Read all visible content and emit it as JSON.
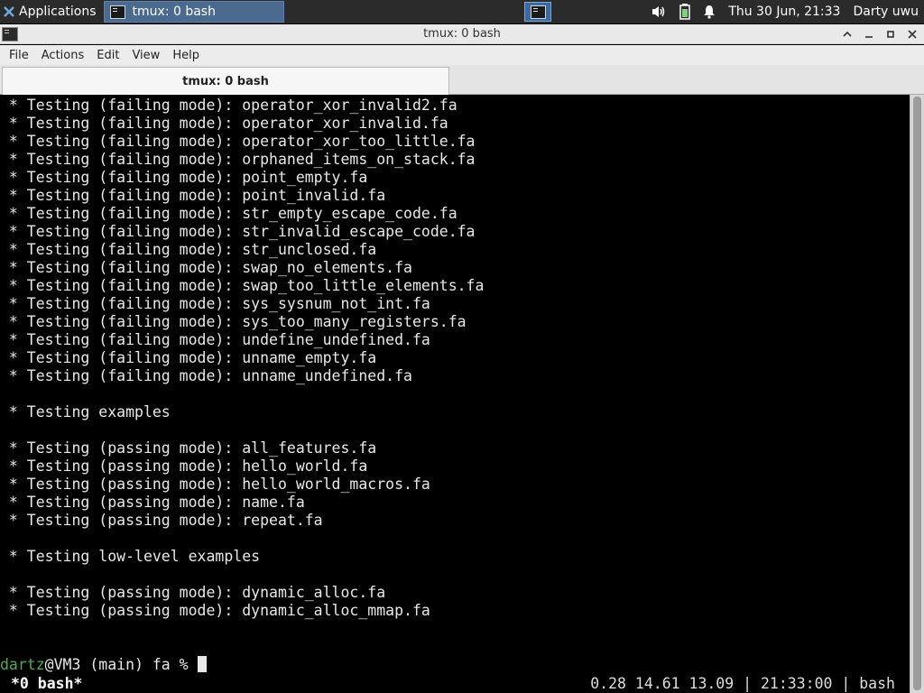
{
  "panel": {
    "applications_label": "Applications",
    "task_label": "tmux: 0 bash",
    "clock": "Thu 30 Jun, 21:33",
    "user": "Darty uwu",
    "icons": [
      "volume-icon",
      "battery-icon",
      "notification-bell-icon"
    ]
  },
  "window": {
    "title": "tmux: 0 bash",
    "menu": [
      "File",
      "Actions",
      "Edit",
      "View",
      "Help"
    ],
    "tab_label": "tmux: 0 bash"
  },
  "terminal": {
    "lines": [
      " * Testing (failing mode): operator_xor_invalid2.fa",
      " * Testing (failing mode): operator_xor_invalid.fa",
      " * Testing (failing mode): operator_xor_too_little.fa",
      " * Testing (failing mode): orphaned_items_on_stack.fa",
      " * Testing (failing mode): point_empty.fa",
      " * Testing (failing mode): point_invalid.fa",
      " * Testing (failing mode): str_empty_escape_code.fa",
      " * Testing (failing mode): str_invalid_escape_code.fa",
      " * Testing (failing mode): str_unclosed.fa",
      " * Testing (failing mode): swap_no_elements.fa",
      " * Testing (failing mode): swap_too_little_elements.fa",
      " * Testing (failing mode): sys_sysnum_not_int.fa",
      " * Testing (failing mode): sys_too_many_registers.fa",
      " * Testing (failing mode): undefine_undefined.fa",
      " * Testing (failing mode): unname_empty.fa",
      " * Testing (failing mode): unname_undefined.fa",
      "",
      " * Testing examples",
      "",
      " * Testing (passing mode): all_features.fa",
      " * Testing (passing mode): hello_world.fa",
      " * Testing (passing mode): hello_world_macros.fa",
      " * Testing (passing mode): name.fa",
      " * Testing (passing mode): repeat.fa",
      "",
      " * Testing low-level examples",
      "",
      " * Testing (passing mode): dynamic_alloc.fa",
      " * Testing (passing mode): dynamic_alloc_mmap.fa"
    ],
    "prompt_user": "dartz",
    "prompt_rest": "@VM3 (main) fa % ",
    "status_left": "*0 bash*",
    "status_right": "0.28 14.61 13.09 | 21:33:00 | bash",
    "user_color": "#4cae4c"
  }
}
